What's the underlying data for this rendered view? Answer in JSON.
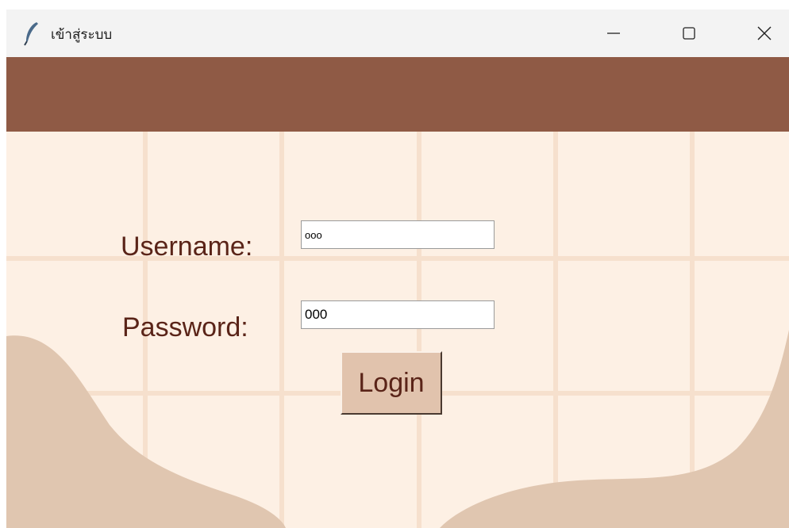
{
  "window": {
    "title": "เข้าสู่ระบบ",
    "icon": "feather-icon",
    "controls": [
      "minimize-icon",
      "maximize-icon",
      "close-icon"
    ]
  },
  "form": {
    "username_label": "Username:",
    "username_value": "ooo",
    "password_label": "Password:",
    "password_value": "000",
    "login_label": "Login"
  },
  "colors": {
    "header_band": "#8f5a45",
    "background": "#fdf0e4",
    "wave": "#e0c6b0",
    "label_text": "#5a2418",
    "button_bg": "#e1c3ad"
  }
}
